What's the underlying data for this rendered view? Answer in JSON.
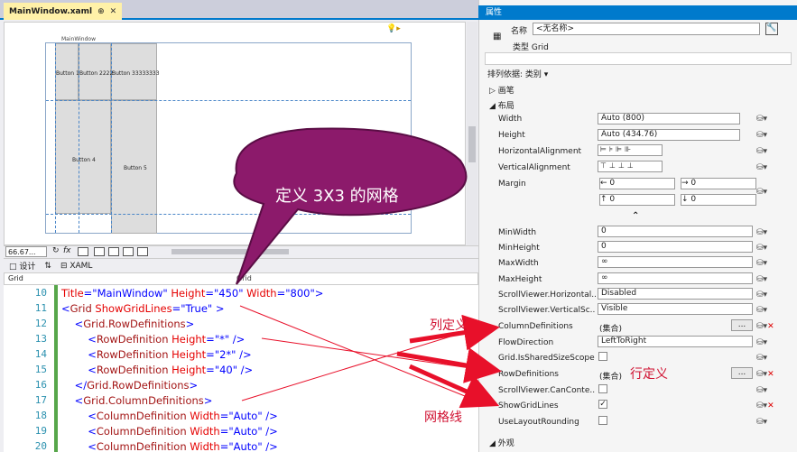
{
  "tab": {
    "title": "MainWindow.xaml",
    "pin": "⊕",
    "close": "✕",
    "tools": "▾ ✱"
  },
  "designer": {
    "window_title": "MainWindow",
    "buttons": [
      "Button 1",
      "Button 2222",
      "Button 33333333",
      "Button 4",
      "Button 5"
    ],
    "zoom": "66.67...",
    "fx": "fx"
  },
  "split": {
    "design": "设计",
    "swap": "⇅",
    "xaml": "XAML"
  },
  "combo": {
    "left": "Grid",
    "right": "Grid"
  },
  "code": {
    "lines": [
      {
        "n": "10",
        "parts": [
          {
            "c": "at",
            "t": "Title"
          },
          {
            "c": "pn",
            "t": "="
          },
          {
            "c": "vl",
            "t": "\"MainWindow\""
          },
          {
            "c": "at",
            "t": " Height"
          },
          {
            "c": "pn",
            "t": "="
          },
          {
            "c": "vl",
            "t": "\"450\""
          },
          {
            "c": "at",
            "t": " Width"
          },
          {
            "c": "pn",
            "t": "="
          },
          {
            "c": "vl",
            "t": "\"800\""
          },
          {
            "c": "pn",
            "t": ">"
          }
        ]
      },
      {
        "n": "11",
        "parts": [
          {
            "c": "pn",
            "t": "<"
          },
          {
            "c": "tg",
            "t": "Grid"
          },
          {
            "c": "at",
            "t": " ShowGridLines"
          },
          {
            "c": "pn",
            "t": "="
          },
          {
            "c": "vl",
            "t": "\"True\""
          },
          {
            "c": "pn",
            "t": " >"
          }
        ]
      },
      {
        "n": "12",
        "parts": [
          {
            "c": "pn",
            "t": "    <"
          },
          {
            "c": "tg",
            "t": "Grid.RowDefinitions"
          },
          {
            "c": "pn",
            "t": ">"
          }
        ]
      },
      {
        "n": "13",
        "parts": [
          {
            "c": "pn",
            "t": "        <"
          },
          {
            "c": "tg",
            "t": "RowDefinition"
          },
          {
            "c": "at",
            "t": " Height"
          },
          {
            "c": "pn",
            "t": "="
          },
          {
            "c": "vl",
            "t": "\"*\""
          },
          {
            "c": "pn",
            "t": " />"
          }
        ]
      },
      {
        "n": "14",
        "parts": [
          {
            "c": "pn",
            "t": "        <"
          },
          {
            "c": "tg",
            "t": "RowDefinition"
          },
          {
            "c": "at",
            "t": " Height"
          },
          {
            "c": "pn",
            "t": "="
          },
          {
            "c": "vl",
            "t": "\"2*\""
          },
          {
            "c": "pn",
            "t": " />"
          }
        ]
      },
      {
        "n": "15",
        "parts": [
          {
            "c": "pn",
            "t": "        <"
          },
          {
            "c": "tg",
            "t": "RowDefinition"
          },
          {
            "c": "at",
            "t": " Height"
          },
          {
            "c": "pn",
            "t": "="
          },
          {
            "c": "vl",
            "t": "\"40\""
          },
          {
            "c": "pn",
            "t": " />"
          }
        ]
      },
      {
        "n": "16",
        "parts": [
          {
            "c": "pn",
            "t": "    </"
          },
          {
            "c": "tg",
            "t": "Grid.RowDefinitions"
          },
          {
            "c": "pn",
            "t": ">"
          }
        ]
      },
      {
        "n": "17",
        "parts": [
          {
            "c": "pn",
            "t": "    <"
          },
          {
            "c": "tg",
            "t": "Grid.ColumnDefinitions"
          },
          {
            "c": "pn",
            "t": ">"
          }
        ]
      },
      {
        "n": "18",
        "parts": [
          {
            "c": "pn",
            "t": "        <"
          },
          {
            "c": "tg",
            "t": "ColumnDefinition"
          },
          {
            "c": "at",
            "t": " Width"
          },
          {
            "c": "pn",
            "t": "="
          },
          {
            "c": "vl",
            "t": "\"Auto\""
          },
          {
            "c": "pn",
            "t": " />"
          }
        ]
      },
      {
        "n": "19",
        "parts": [
          {
            "c": "pn",
            "t": "        <"
          },
          {
            "c": "tg",
            "t": "ColumnDefinition"
          },
          {
            "c": "at",
            "t": " Width"
          },
          {
            "c": "pn",
            "t": "="
          },
          {
            "c": "vl",
            "t": "\"Auto\""
          },
          {
            "c": "pn",
            "t": " />"
          }
        ]
      },
      {
        "n": "20",
        "parts": [
          {
            "c": "pn",
            "t": "        <"
          },
          {
            "c": "tg",
            "t": "ColumnDefinition"
          },
          {
            "c": "at",
            "t": " Width"
          },
          {
            "c": "pn",
            "t": "="
          },
          {
            "c": "vl",
            "t": "\"Auto\""
          },
          {
            "c": "pn",
            "t": " />"
          }
        ]
      }
    ]
  },
  "properties": {
    "title": "属性",
    "name_label": "名称",
    "name_value": "<无名称>",
    "type_label": "类型",
    "type_value": "Grid",
    "sort": "排列依据: 类别 ▾",
    "cat_brush": "画笔",
    "cat_layout": "布局",
    "cat_appearance": "外观",
    "width_label": "Width",
    "width_value": "Auto (800)",
    "height_label": "Height",
    "height_value": "Auto (434.76)",
    "halign_label": "HorizontalAlignment",
    "valign_label": "VerticalAlignment",
    "margin_label": "Margin",
    "margin_vals": [
      "0",
      "0",
      "0",
      "0"
    ],
    "rows": [
      {
        "label": "MinWidth",
        "value": "0"
      },
      {
        "label": "MinHeight",
        "value": "0"
      },
      {
        "label": "MaxWidth",
        "value": "∞"
      },
      {
        "label": "MaxHeight",
        "value": "∞"
      },
      {
        "label": "ScrollViewer.Horizontal...",
        "value": "Disabled"
      },
      {
        "label": "ScrollViewer.VerticalSc...",
        "value": "Visible"
      }
    ],
    "coldef_label": "ColumnDefinitions",
    "coldef_value": "(集合)",
    "flow_label": "FlowDirection",
    "flow_value": "LeftToRight",
    "shared_label": "Grid.IsSharedSizeScope",
    "rowdef_label": "RowDefinitions",
    "rowdef_value": "(集合)",
    "scrollcan_label": "ScrollViewer.CanConte...",
    "showgrid_label": "ShowGridLines",
    "layoutround_label": "UseLayoutRounding",
    "ellipsis": "...",
    "expand": "⌃"
  },
  "annotations": {
    "bubble": "定义 3X3 的网格",
    "col": "列定义",
    "row": "行定义",
    "grid": "网格线"
  }
}
